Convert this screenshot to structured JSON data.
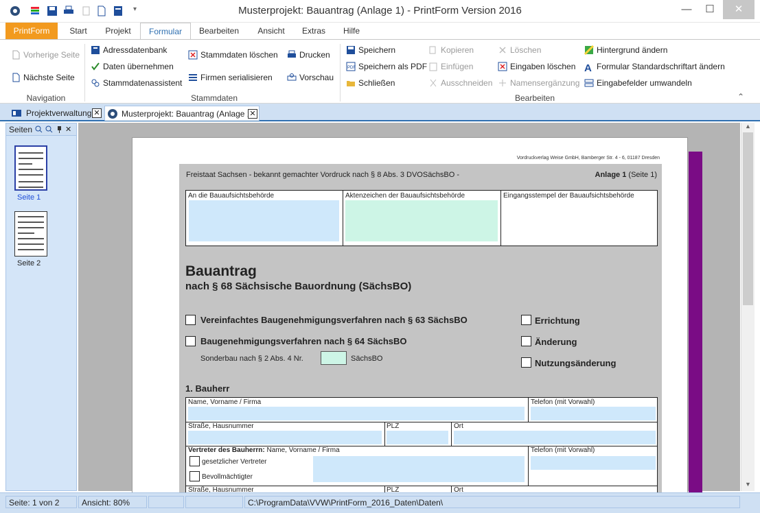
{
  "window": {
    "title": "Musterprojekt: Bauantrag (Anlage 1) - PrintForm Version 2016",
    "minimize": "—",
    "maximize": "☐",
    "close": "✕"
  },
  "tabs": {
    "printform": "PrintForm",
    "start": "Start",
    "projekt": "Projekt",
    "formular": "Formular",
    "bearbeiten": "Bearbeiten",
    "ansicht": "Ansicht",
    "extras": "Extras",
    "hilfe": "Hilfe"
  },
  "ribbon": {
    "navigation": {
      "label": "Navigation",
      "prev": "Vorherige Seite",
      "next": "Nächste Seite"
    },
    "stammdaten": {
      "label": "Stammdaten",
      "adressdatenbank": "Adressdatenbank",
      "daten_uebernehmen": "Daten übernehmen",
      "assistent": "Stammdatenassistent",
      "loeschen": "Stammdaten löschen",
      "serialisieren": "Firmen serialisieren",
      "drucken": "Drucken",
      "vorschau": "Vorschau"
    },
    "bearbeiten": {
      "label": "Bearbeiten",
      "speichern": "Speichern",
      "speichern_pdf": "Speichern als PDF",
      "schliessen": "Schließen",
      "kopieren": "Kopieren",
      "einfuegen": "Einfügen",
      "ausschneiden": "Ausschneiden",
      "loeschen": "Löschen",
      "eingaben_loeschen": "Eingaben löschen",
      "namensergaenzung": "Namensergänzung",
      "hintergrund": "Hintergrund ändern",
      "schriftart": "Formular Standardschriftart ändern",
      "umwandeln": "Eingabefelder umwandeln"
    },
    "collapse": "⌃"
  },
  "doctabs": {
    "projektverwaltung": "Projektverwaltung",
    "musterprojekt": "Musterprojekt: Bauantrag (Anlage 1)",
    "close": "✕"
  },
  "sidepanel": {
    "title": "Seiten",
    "close": "✕",
    "pages": [
      {
        "label": "Seite 1"
      },
      {
        "label": "Seite 2"
      }
    ]
  },
  "form": {
    "publisher": "Vordruckverlag Weise GmbH, Bamberger Str. 4 - 6, 01187 Dresden",
    "header_left": "Freistaat Sachsen - bekannt gemachter Vordruck nach § 8 Abs. 3 DVOSächsBO -",
    "header_right_bold": "Anlage 1",
    "header_right": "(Seite 1)",
    "box1": "An die Bauaufsichtsbehörde",
    "box2": "Aktenzeichen der Bauaufsichtsbehörde",
    "box3": "Eingangsstempel der Bauaufsichtsbehörde",
    "title": "Bauantrag",
    "subtitle": "nach § 68 Sächsische Bauordnung (SächsBO)",
    "opt1": "Vereinfachtes Baugenehmigungsverfahren nach § 63 SächsBO",
    "opt2": "Baugenehmigungsverfahren nach § 64 SächsBO",
    "sonderbau": "Sonderbau nach § 2 Abs. 4 Nr.",
    "saechsbo": "SächsBO",
    "errichtung": "Errichtung",
    "aenderung": "Änderung",
    "nutzungsaenderung": "Nutzungsänderung",
    "section1": "1. Bauherr",
    "name": "Name, Vorname / Firma",
    "telefon": "Telefon (mit Vorwahl)",
    "strasse": "Straße, Hausnummer",
    "plz": "PLZ",
    "ort": "Ort",
    "vertreter_bold": "Vertreter des Bauherrn:",
    "vertreter_rest": "Name, Vorname / Firma",
    "gesetzlich": "gesetzlicher Vertreter",
    "bevollmaechtigt": "Bevollmächtigter"
  },
  "status": {
    "seite": "Seite: 1 von 2",
    "ansicht": "Ansicht: 80%",
    "pfad": "C:\\ProgramData\\VVW\\PrintForm_2016_Daten\\Daten\\"
  },
  "colors": {
    "accent": "#2e6fb0",
    "printform_tab": "#f29a1f",
    "purple_bar": "#7a0c85"
  }
}
